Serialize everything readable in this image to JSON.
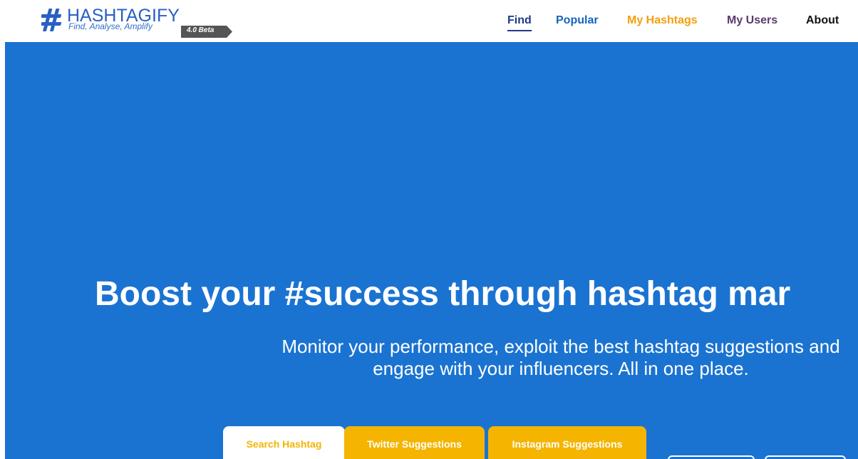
{
  "brand": {
    "name": "HASHTAGIFY",
    "tagline": "Find, Analyse, Amplify",
    "badge": "4.0 Beta",
    "color": "#2a60c2"
  },
  "nav": {
    "find": "Find",
    "popular": "Popular",
    "my_hashtags": "My Hashtags",
    "my_users": "My Users",
    "about": "About"
  },
  "hero": {
    "title": "Boost your #success through hashtag mar",
    "subtitle_line1": "Monitor your performance, exploit the best hashtag suggestions and",
    "subtitle_line2": "engage with your influencers. All in one place.",
    "background": "#1a73d1"
  },
  "tabs": {
    "search": "Search Hashtag",
    "twitter": "Twitter Suggestions",
    "instagram": "Instagram Suggestions",
    "accent": "#f4b400"
  }
}
